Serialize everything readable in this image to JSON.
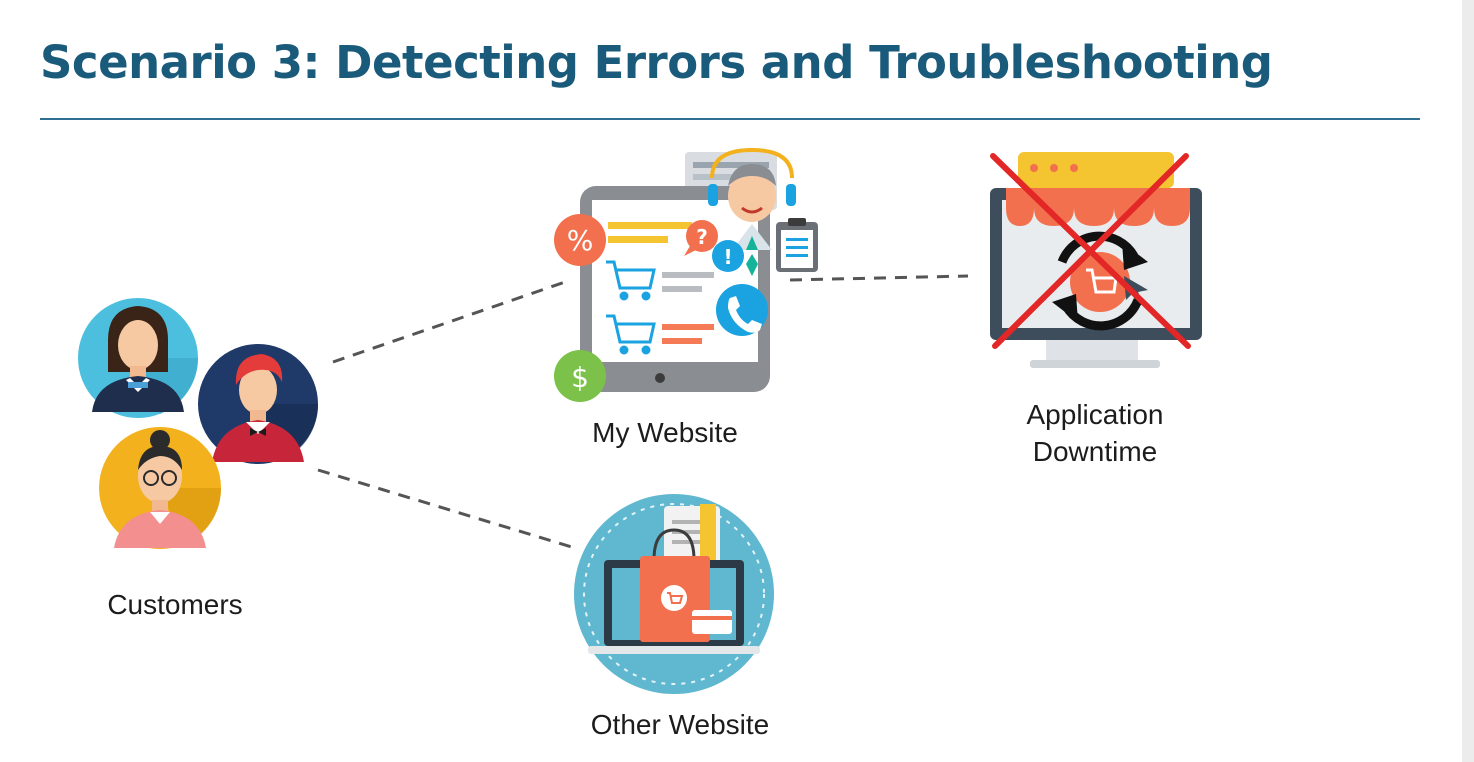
{
  "slide": {
    "title": "Scenario 3: Detecting Errors and Troubleshooting"
  },
  "nodes": {
    "customers": {
      "label": "Customers",
      "icon": "customers-avatars-icon"
    },
    "my_website": {
      "label": "My Website",
      "icon": "website-tablet-icon"
    },
    "other_website": {
      "label": "Other Website",
      "icon": "shopping-bag-laptop-icon"
    },
    "downtime": {
      "line1": "Application",
      "line2": "Downtime",
      "icon": "broken-store-monitor-icon"
    }
  },
  "colors": {
    "title": "#1a5a7a",
    "rule": "#2f6f93",
    "connector": "#555555",
    "cross": "#e32626"
  }
}
